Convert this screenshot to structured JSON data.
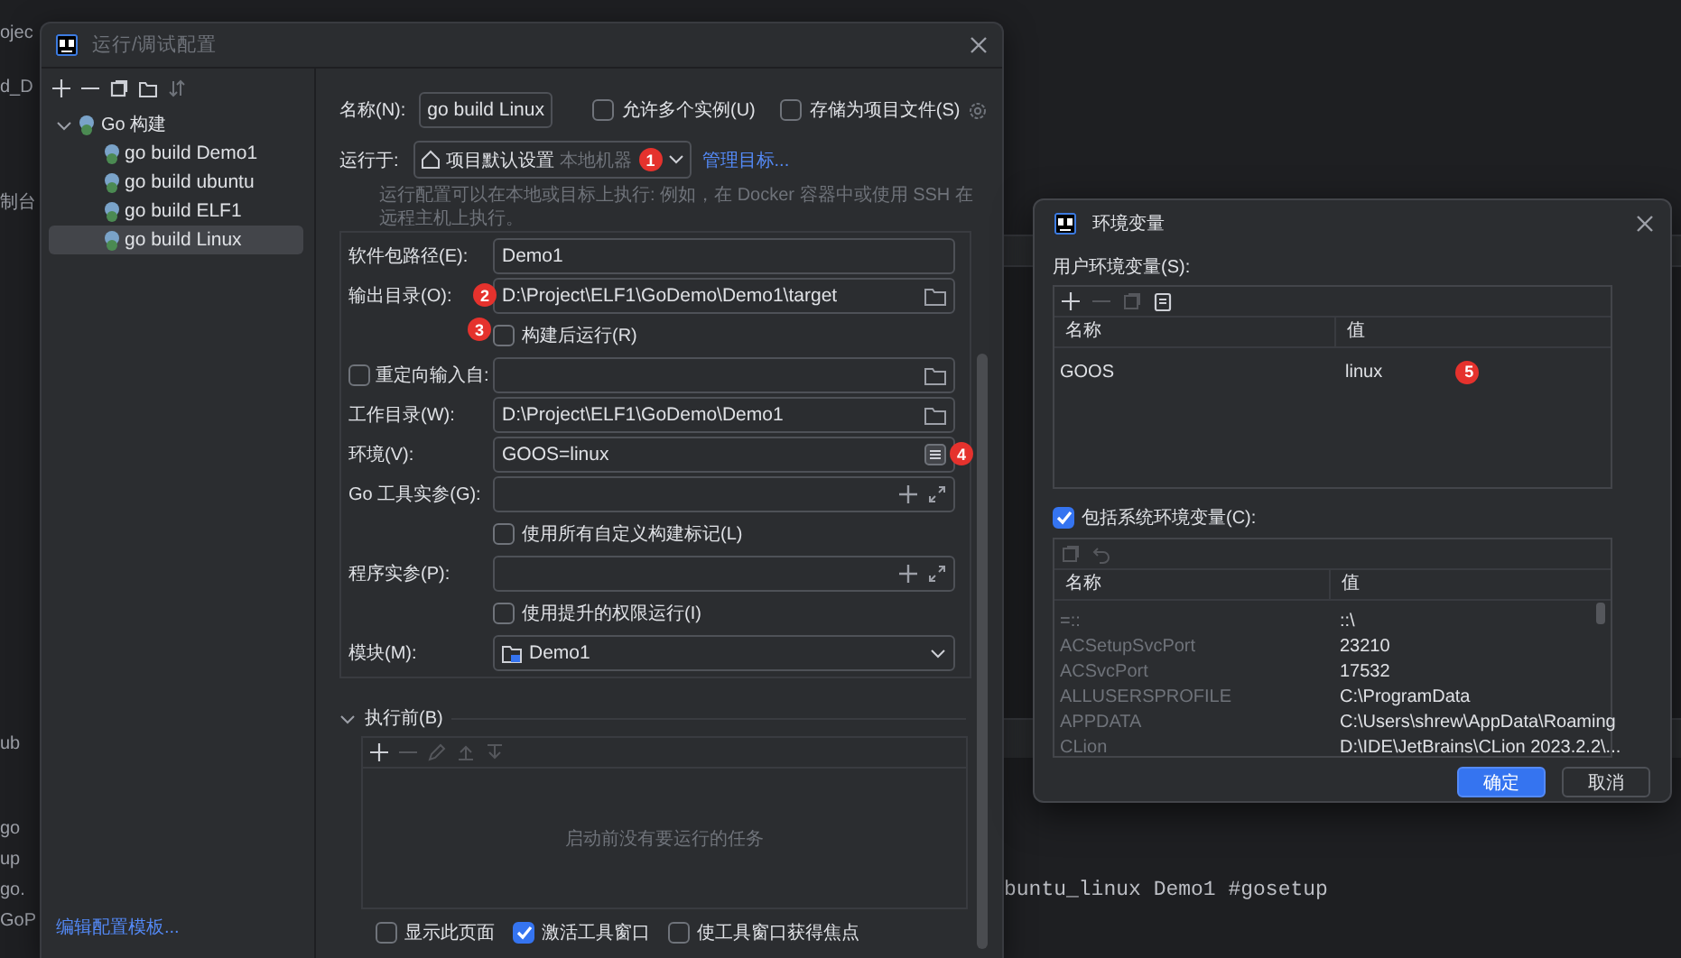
{
  "ide_background": {
    "left_fragments": [
      "ojec",
      "d_D",
      "制台",
      "ub",
      "go",
      "up",
      "go.",
      "GoP"
    ],
    "console_line": "buntu_linux Demo1 #gosetup"
  },
  "run_dialog": {
    "title": "运行/调试配置",
    "tree": [
      {
        "label": "Go 构建",
        "expanded": true,
        "children": [
          {
            "label": "go build Demo1",
            "selected": false
          },
          {
            "label": "go build ubuntu",
            "selected": false
          },
          {
            "label": "go build ELF1",
            "selected": false
          },
          {
            "label": "go build Linux",
            "selected": true
          }
        ]
      }
    ],
    "edit_templates_link": "编辑配置模板...",
    "name_label": "名称(N):",
    "name_value": "go build Linux",
    "top_options": [
      {
        "label": "允许多个实例(U)",
        "checked": false
      },
      {
        "label": "存储为项目文件(S)",
        "checked": false
      }
    ],
    "run_on": {
      "label": "运行于:",
      "target": "项目默认设置",
      "target_detail": "本地机器",
      "badge": "1",
      "link": "管理目标..."
    },
    "hint": "运行配置可以在本地或目标上执行: 例如，在 Docker 容器中或使用 SSH 在远程主机上执行。",
    "rows": [
      {
        "kind": "field",
        "label": "软件包路径(E):",
        "value": "Demo1"
      },
      {
        "kind": "path_field",
        "label": "输出目录(O):",
        "value": "D:\\Project\\ELF1\\GoDemo\\Demo1\\target",
        "badge": "2"
      },
      {
        "kind": "check",
        "label": "构建后运行(R)",
        "checked": false,
        "badge": "3"
      },
      {
        "kind": "check_path_field",
        "label": "重定向输入自:",
        "checked": false
      },
      {
        "kind": "path_field",
        "label": "工作目录(W):",
        "value": "D:\\Project\\ELF1\\GoDemo\\Demo1"
      },
      {
        "kind": "env_field",
        "label": "环境(V):",
        "value": "GOOS=linux",
        "badge": "4"
      },
      {
        "kind": "args_field",
        "label": "Go 工具实参(G):"
      },
      {
        "kind": "check",
        "label": "使用所有自定义构建标记(L)",
        "checked": false
      },
      {
        "kind": "args_field",
        "label": "程序实参(P):"
      },
      {
        "kind": "check",
        "label": "使用提升的权限运行(I)",
        "checked": false
      },
      {
        "kind": "dropdown",
        "label": "模块(M):",
        "value": "Demo1"
      }
    ],
    "before_launch": {
      "title": "执行前(B)",
      "expanded": true,
      "empty_text": "启动前没有要运行的任务"
    },
    "bottom_options": [
      {
        "label": "显示此页面",
        "checked": false
      },
      {
        "label": "激活工具窗口",
        "checked": true
      },
      {
        "label": "使工具窗口获得焦点",
        "checked": false
      }
    ]
  },
  "env_dialog": {
    "title": "环境变量",
    "user_label": "用户环境变量(S):",
    "user_columns": [
      "名称",
      "值"
    ],
    "user_rows": [
      {
        "name": "GOOS",
        "value": "linux",
        "badge": "5"
      }
    ],
    "include_system": {
      "label": "包括系统环境变量(C):",
      "checked": true
    },
    "system_columns": [
      "名称",
      "值"
    ],
    "system_rows": [
      {
        "name": "=::",
        "value": "::\\"
      },
      {
        "name": "ACSetupSvcPort",
        "value": "23210"
      },
      {
        "name": "ACSvcPort",
        "value": "17532"
      },
      {
        "name": "ALLUSERSPROFILE",
        "value": "C:\\ProgramData"
      },
      {
        "name": "APPDATA",
        "value": "C:\\Users\\shrew\\AppData\\Roaming"
      },
      {
        "name": "CLion",
        "value": "D:\\IDE\\JetBrains\\CLion 2023.2.2\\..."
      }
    ],
    "buttons": [
      {
        "label": "确定",
        "primary": true
      },
      {
        "label": "取消",
        "primary": false
      }
    ]
  }
}
